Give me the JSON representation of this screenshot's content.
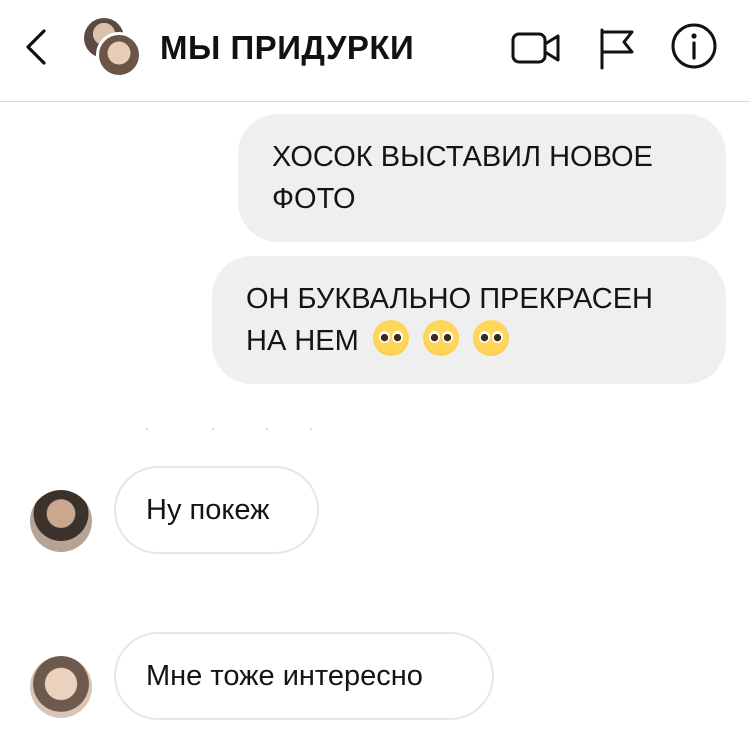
{
  "header": {
    "title": "МЫ ПРИДУРКИ",
    "back_icon": "chevron-left-icon",
    "video_icon": "video-camera-icon",
    "flag_icon": "flag-icon",
    "info_icon": "info-icon"
  },
  "messages": [
    {
      "direction": "outgoing",
      "text_line1": "ХОСОК ВЫСТАВИЛ НОВОЕ",
      "text_line2": "ФОТО"
    },
    {
      "direction": "outgoing",
      "text_line1": "ОН БУКВАЛЬНО ПРЕКРАСЕН",
      "text_line2": "НА НЕМ",
      "emoji": "pleading-face-emoji",
      "emoji_count": 3
    },
    {
      "direction": "incoming",
      "text": "Ну покеж",
      "avatar": "avatar"
    },
    {
      "direction": "incoming",
      "text": "Мне тоже интересно",
      "avatar": "avatar"
    }
  ],
  "colors": {
    "outgoing_bubble": "#efefef",
    "incoming_border": "#e6e6e6",
    "header_border": "#dbdbdb"
  }
}
